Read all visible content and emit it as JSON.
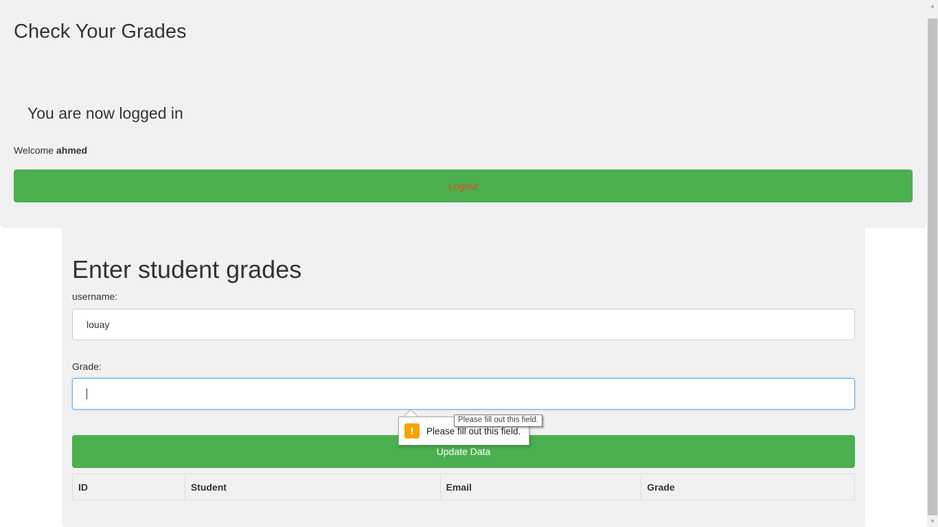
{
  "header": {
    "title": "Check Your Grades"
  },
  "session": {
    "status": "You are now logged in",
    "welcome_prefix": "Welcome ",
    "username": "ahmed",
    "logout_label": "Logout"
  },
  "form": {
    "title": "Enter student grades",
    "username_label": "username:",
    "username_value": "louay",
    "grade_label": "Grade:",
    "grade_value": "",
    "submit_label": "Update Data"
  },
  "table": {
    "columns": [
      "ID",
      "Student",
      "Email",
      "Grade"
    ]
  },
  "validation": {
    "message": "Please fill out this field.",
    "tooltip": "Please fill out this field."
  },
  "scrollbar": {
    "up_icon": "▲",
    "down_icon": "▼"
  },
  "colors": {
    "button_green": "#4caf50",
    "logout_text": "#e8451f",
    "warning": "#f5a300",
    "panel_bg": "#f1f1f1"
  }
}
